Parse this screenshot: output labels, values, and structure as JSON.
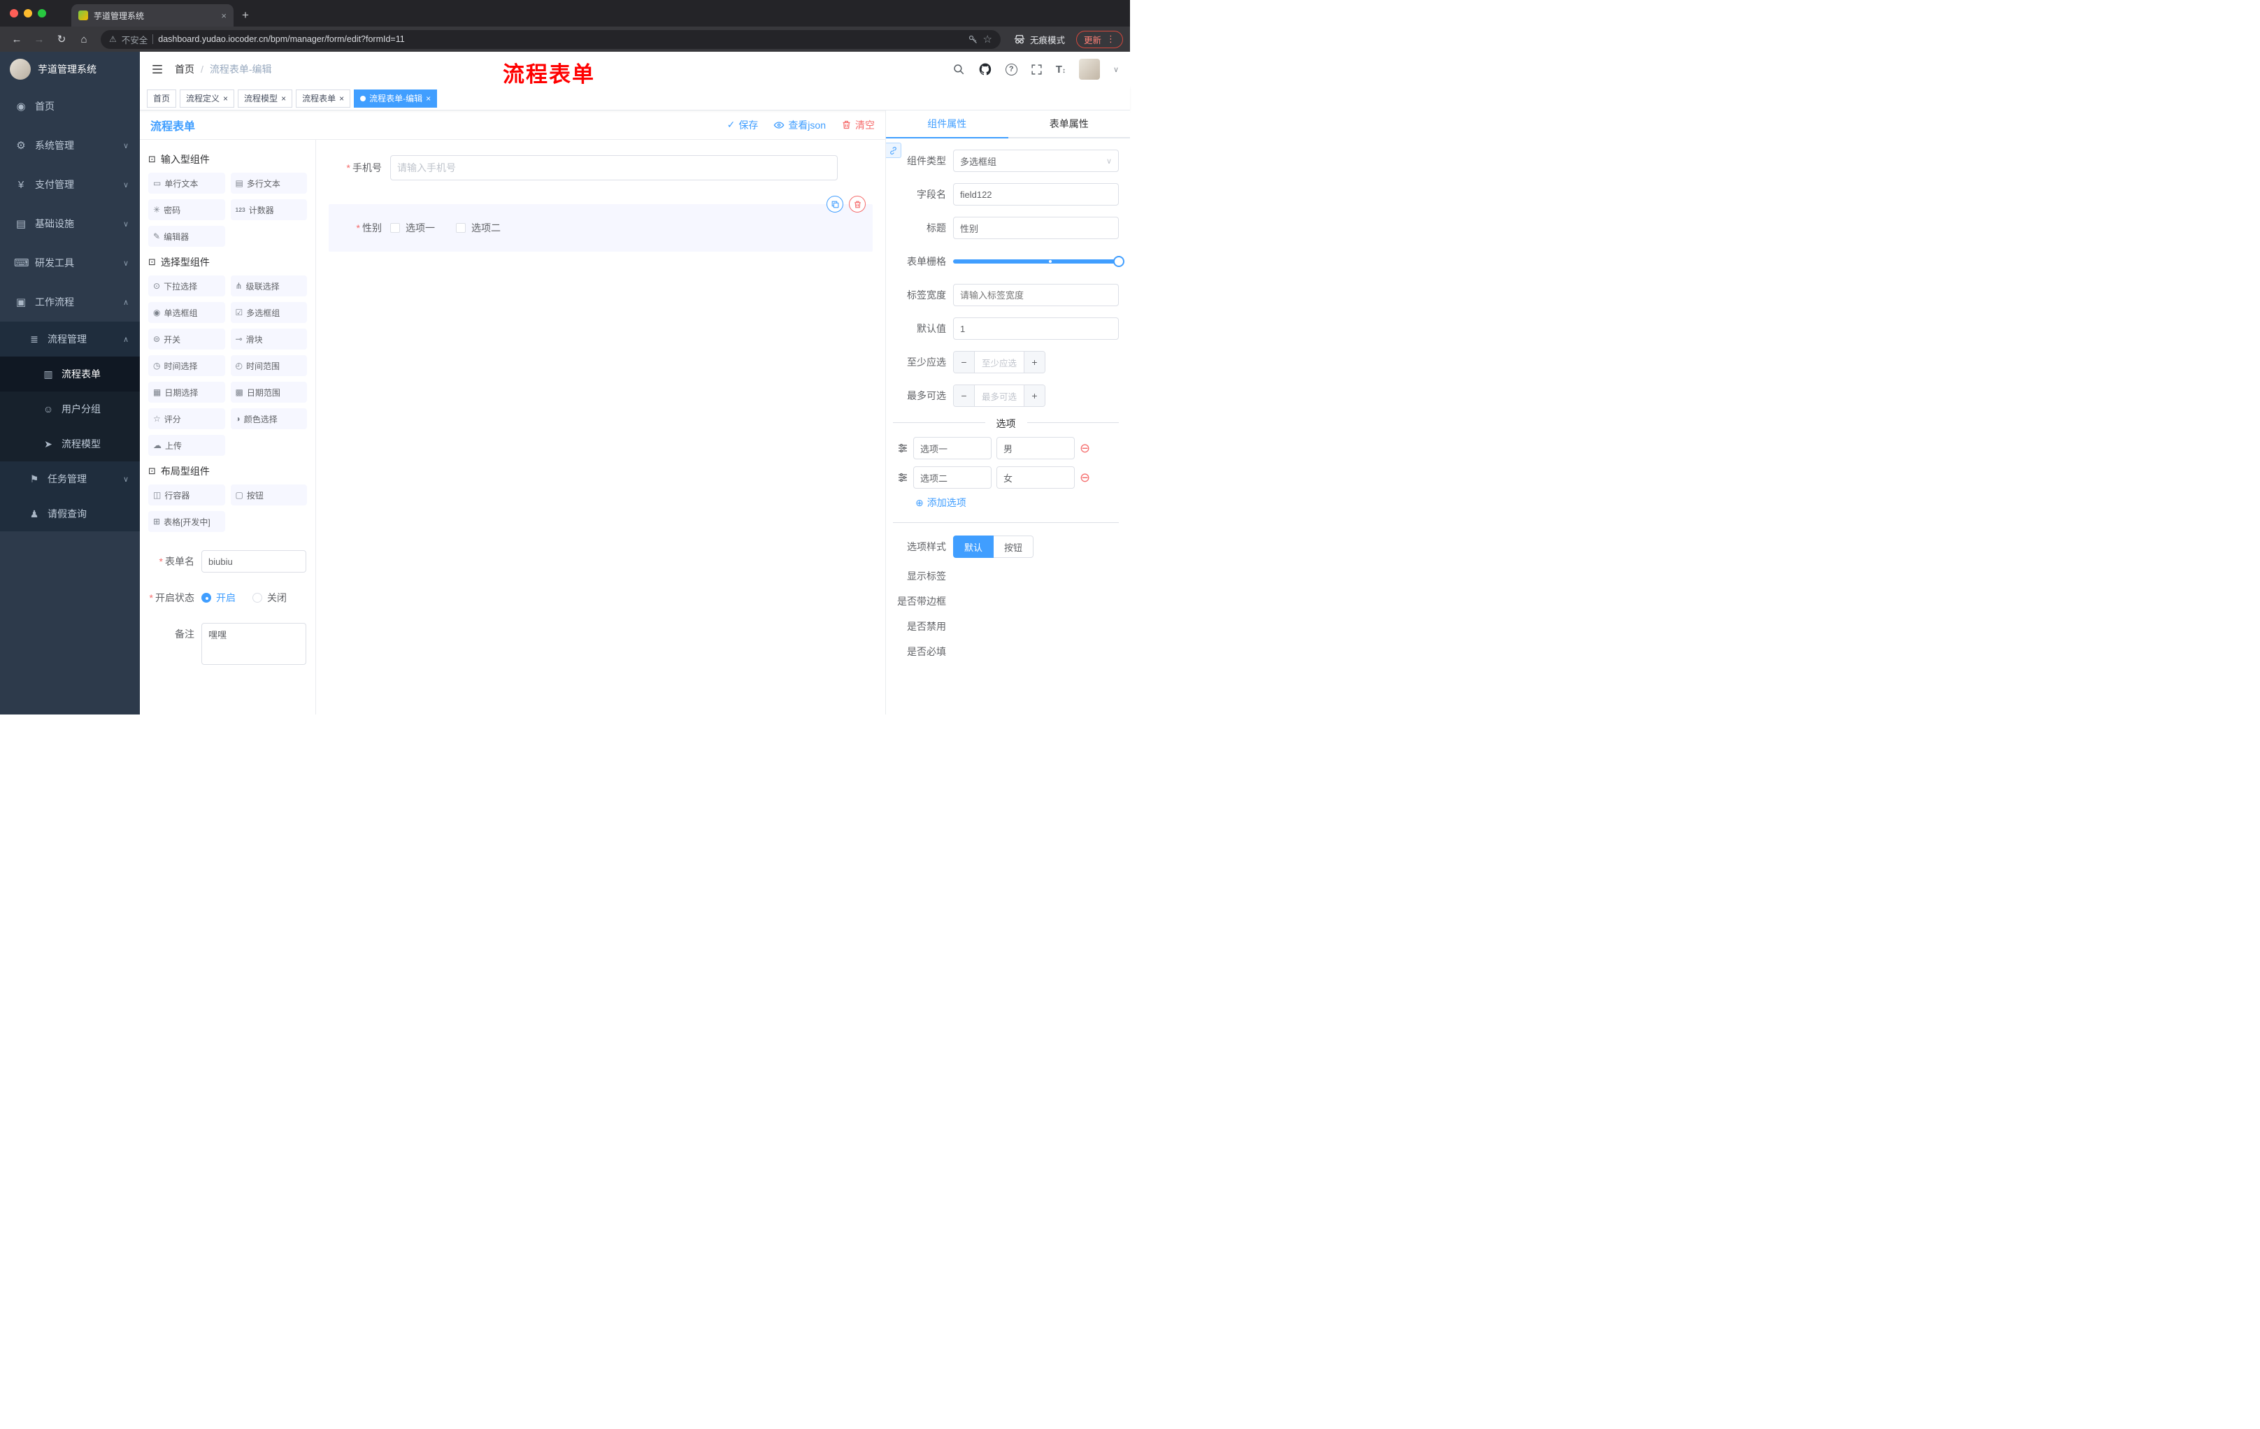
{
  "colors": {
    "accent": "#409eff",
    "danger": "#f56c6c",
    "sidebar_bg": "#2d3a4b",
    "sidebar_submenu_bg": "#1f2d3d",
    "annotation_red": "#ff0000",
    "active_tag_bg": "#409eff",
    "component_item_bg": "#f6f7ff"
  },
  "glyphs": {
    "close": "×",
    "plus": "+",
    "minus": "−",
    "dot": "●",
    "caret_down": "∨",
    "caret_up": "∧",
    "slash": "/",
    "ellipsis": "⋮",
    "warning": "⚠",
    "check": "✓",
    "star": "☆",
    "back": "←",
    "forward": "→",
    "reload": "↻",
    "home": "⌂",
    "add_circle": "⊕",
    "remove_circle": "⊖",
    "asterisk": "*",
    "question": "?",
    "font_size": "T",
    "updown": "↕"
  },
  "browser": {
    "tab_title": "芋道管理系统",
    "url_security": "不安全",
    "url": "dashboard.yudao.iocoder.cn/bpm/manager/form/edit?formId=11",
    "incognito_label": "无痕模式",
    "update_label": "更新"
  },
  "sidebar": {
    "logo_title": "芋道管理系统",
    "items": [
      {
        "label": "首页",
        "icon": "home-icon",
        "glyph": "◉",
        "arrow": ""
      },
      {
        "label": "系统管理",
        "icon": "gear-icon",
        "glyph": "⚙",
        "arrow": "∨"
      },
      {
        "label": "支付管理",
        "icon": "yen-icon",
        "glyph": "¥",
        "arrow": "∨"
      },
      {
        "label": "基础设施",
        "icon": "infrastructure-icon",
        "glyph": "▤",
        "arrow": "∨"
      },
      {
        "label": "研发工具",
        "icon": "devtools-icon",
        "glyph": "⌨",
        "arrow": "∨"
      },
      {
        "label": "工作流程",
        "icon": "workflow-icon",
        "glyph": "▣",
        "arrow": "∧"
      }
    ],
    "workflow": {
      "process_mgmt": {
        "label": "流程管理",
        "icon": "list-icon",
        "glyph": "≣",
        "arrow": "∧"
      },
      "process_children": [
        {
          "label": "流程表单",
          "icon": "form-icon",
          "glyph": "▥",
          "active": true
        },
        {
          "label": "用户分组",
          "icon": "user-group-icon",
          "glyph": "☺",
          "active": false
        },
        {
          "label": "流程模型",
          "icon": "paper-plane-icon",
          "glyph": "➤",
          "active": false
        }
      ],
      "task_mgmt": {
        "label": "任务管理",
        "icon": "task-icon",
        "glyph": "⚑",
        "arrow": "∨"
      },
      "leave_query": {
        "label": "请假查询",
        "icon": "person-icon",
        "glyph": "♟"
      }
    }
  },
  "header": {
    "breadcrumb_home": "首页",
    "breadcrumb_current": "流程表单-编辑",
    "annotation": "流程表单"
  },
  "tags": [
    {
      "label": "首页",
      "closable": false,
      "active": false
    },
    {
      "label": "流程定义",
      "closable": true,
      "active": false
    },
    {
      "label": "流程模型",
      "closable": true,
      "active": false
    },
    {
      "label": "流程表单",
      "closable": true,
      "active": false
    },
    {
      "label": "流程表单-编辑",
      "closable": true,
      "active": true
    }
  ],
  "designer": {
    "title": "流程表单",
    "actions": {
      "save": "保存",
      "view_json": "查看json",
      "clear": "清空"
    },
    "palette": {
      "groups": [
        {
          "title": "输入型组件",
          "items": [
            {
              "label": "单行文本",
              "icon": "single-line-text-icon",
              "glyph": "▭"
            },
            {
              "label": "多行文本",
              "icon": "textarea-icon",
              "glyph": "▤"
            },
            {
              "label": "密码",
              "icon": "password-icon",
              "glyph": "✳"
            },
            {
              "label": "计数器",
              "icon": "counter-icon",
              "glyph": "123"
            },
            {
              "label": "编辑器",
              "icon": "editor-icon",
              "glyph": "✎"
            }
          ]
        },
        {
          "title": "选择型组件",
          "items": [
            {
              "label": "下拉选择",
              "icon": "select-icon",
              "glyph": "⊙"
            },
            {
              "label": "级联选择",
              "icon": "cascader-icon",
              "glyph": "⋔"
            },
            {
              "label": "单选框组",
              "icon": "radio-group-icon",
              "glyph": "◉"
            },
            {
              "label": "多选框组",
              "icon": "checkbox-group-icon",
              "glyph": "☑"
            },
            {
              "label": "开关",
              "icon": "switch-icon",
              "glyph": "⊜"
            },
            {
              "label": "滑块",
              "icon": "slider-icon",
              "glyph": "⊸"
            },
            {
              "label": "时间选择",
              "icon": "time-picker-icon",
              "glyph": "◷"
            },
            {
              "label": "时间范围",
              "icon": "time-range-icon",
              "glyph": "◴"
            },
            {
              "label": "日期选择",
              "icon": "date-picker-icon",
              "glyph": "▦"
            },
            {
              "label": "日期范围",
              "icon": "date-range-icon",
              "glyph": "▩"
            },
            {
              "label": "评分",
              "icon": "rate-icon",
              "glyph": "☆"
            },
            {
              "label": "颜色选择",
              "icon": "color-picker-icon",
              "glyph": "◑"
            },
            {
              "label": "上传",
              "icon": "upload-icon",
              "glyph": "☁"
            }
          ]
        },
        {
          "title": "布局型组件",
          "items": [
            {
              "label": "行容器",
              "icon": "row-container-icon",
              "glyph": "◫"
            },
            {
              "label": "按钮",
              "icon": "button-icon",
              "glyph": "▢"
            },
            {
              "label": "表格[开发中]",
              "icon": "table-icon",
              "glyph": "⊞"
            }
          ]
        }
      ]
    },
    "meta": {
      "form_name_label": "表单名",
      "form_name_value": "biubiu",
      "status_label": "开启状态",
      "status_on": "开启",
      "status_off": "关闭",
      "status_selected": "开启",
      "remark_label": "备注",
      "remark_value": "嘿嘿"
    },
    "canvas": {
      "phone_label": "手机号",
      "phone_placeholder": "请输入手机号",
      "gender_label": "性别",
      "gender_option1": "选项一",
      "gender_option2": "选项二"
    }
  },
  "props": {
    "tab_component": "组件属性",
    "tab_form": "表单属性",
    "active_tab": "组件属性",
    "rows": {
      "type": {
        "label": "组件类型",
        "value": "多选框组"
      },
      "field": {
        "label": "字段名",
        "value": "field122"
      },
      "title": {
        "label": "标题",
        "value": "性别"
      },
      "grid": {
        "label": "表单栅格"
      },
      "label_width": {
        "label": "标签宽度",
        "placeholder": "请输入标签宽度"
      },
      "default": {
        "label": "默认值",
        "value": "1"
      },
      "min": {
        "label": "至少应选",
        "placeholder": "至少应选"
      },
      "max": {
        "label": "最多可选",
        "placeholder": "最多可选"
      }
    },
    "options": {
      "divider_title": "选项",
      "rows": [
        {
          "label": "选项一",
          "value": "男"
        },
        {
          "label": "选项二",
          "value": "女"
        }
      ],
      "add_label": "添加选项"
    },
    "style": {
      "label": "选项样式",
      "default_btn": "默认",
      "button_btn": "按钮",
      "selected": "默认"
    },
    "switches": [
      {
        "label": "显示标签",
        "on": true
      },
      {
        "label": "是否带边框",
        "on": false
      },
      {
        "label": "是否禁用",
        "on": false
      },
      {
        "label": "是否必填",
        "on": true
      }
    ]
  }
}
